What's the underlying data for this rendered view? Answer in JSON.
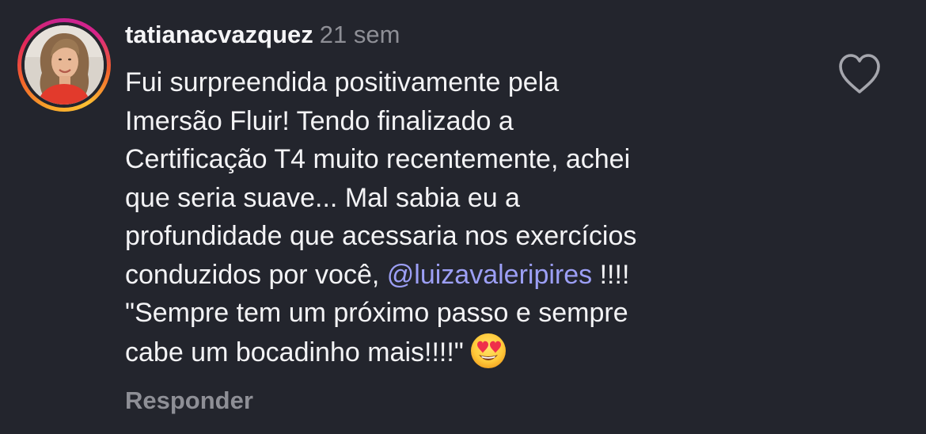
{
  "comment": {
    "username": "tatianacvazquez",
    "time": "21 sem",
    "text_lines": [
      "Fui surpreendida positivamente pela",
      "Imersão Fluir! Tendo finalizado a",
      "Certificação T4 muito recentemente, achei",
      "que seria suave... Mal sabia eu a",
      "profundidade que acessaria nos exercícios"
    ],
    "line6_before": "conduzidos por você, ",
    "mention": "@luizavaleripires",
    "line6_after": " !!!!",
    "line7": "\"Sempre tem um próximo passo e sempre",
    "line8": "cabe um bocadinho mais!!!!\"",
    "emoji": "heart-eyes-emoji",
    "reply_label": "Responder",
    "like_icon": "heart-outline-icon"
  },
  "colors": {
    "background": "#23252d",
    "text": "#f3f3f5",
    "muted": "#8e8f96",
    "mention": "#9c9ff5"
  }
}
